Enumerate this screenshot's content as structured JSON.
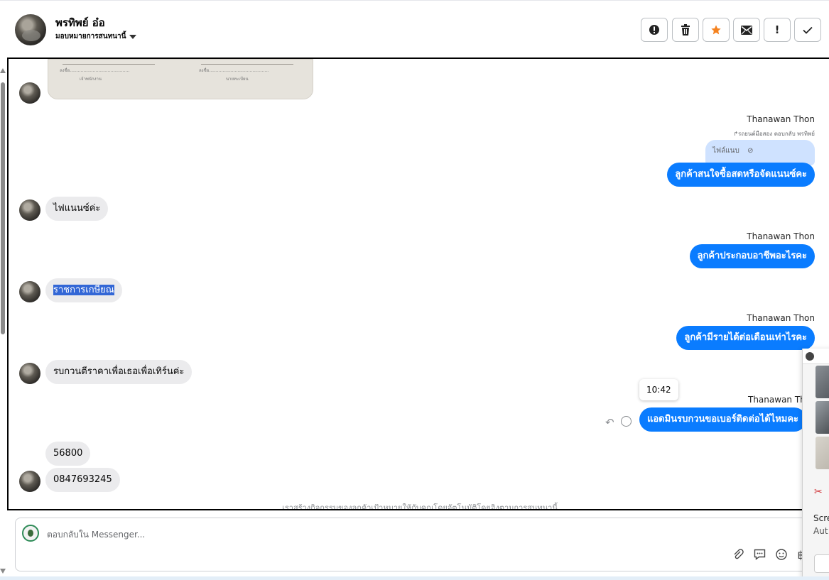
{
  "header": {
    "contact_name": "พรทิพย์ อ๋อ",
    "assign_label": "มอบหมายการสนทนานี้",
    "toolbar": {
      "info_icon": "exclamation-circle-icon",
      "delete_icon": "trash-icon",
      "star_icon": "star-icon",
      "mail_icon": "envelope-icon",
      "alert_label": "!",
      "done_icon": "check-icon"
    }
  },
  "messages": {
    "out1": {
      "sender": "Thanawan Thon",
      "reply_note": "รถยนต์มือสอง ตอบกลับ พรทิพย์",
      "attachment_label": "ไฟล์แนบ",
      "text": "ลูกค้าสนใจซื้อสดหรือจัดแนนซ์คะ"
    },
    "in1": {
      "text": "ไฟแนนซ์ค่ะ"
    },
    "out2": {
      "sender": "Thanawan Thon",
      "text": "ลูกค้าประกอบอาชีพอะไรคะ"
    },
    "in2": {
      "text": "ราชการเกษียณ"
    },
    "out3": {
      "sender": "Thanawan Thon",
      "text": "ลูกค้ามีรายได้ต่อเดือนเท่าไรคะ"
    },
    "in3": {
      "text": "รบกวนตีราคาเพื่อเธอเพื่อเทิร์นค่ะ"
    },
    "out4": {
      "sender": "Thanawan Thon",
      "time": "10:42",
      "text": "แอดมินรบกวนขอเบอร์ติดต่อได้ไหมคะ"
    },
    "in4": {
      "text": "56800"
    },
    "in5": {
      "text": "0847693245"
    }
  },
  "footnote": "เราสร้างกิจกรรมของลูกค้าเป้าหมายให้กับคุณโดยอัตโนมัติโดยอิงตามการสนทนานี้",
  "composer": {
    "placeholder": "ตอบกลับใน Messenger..."
  },
  "popup": {
    "title_partial": "Scre",
    "subtitle_partial": "Aut"
  },
  "colors": {
    "outgoing_bubble": "#0a7cff",
    "incoming_bubble": "#ebebed",
    "star": "#f5821f"
  }
}
